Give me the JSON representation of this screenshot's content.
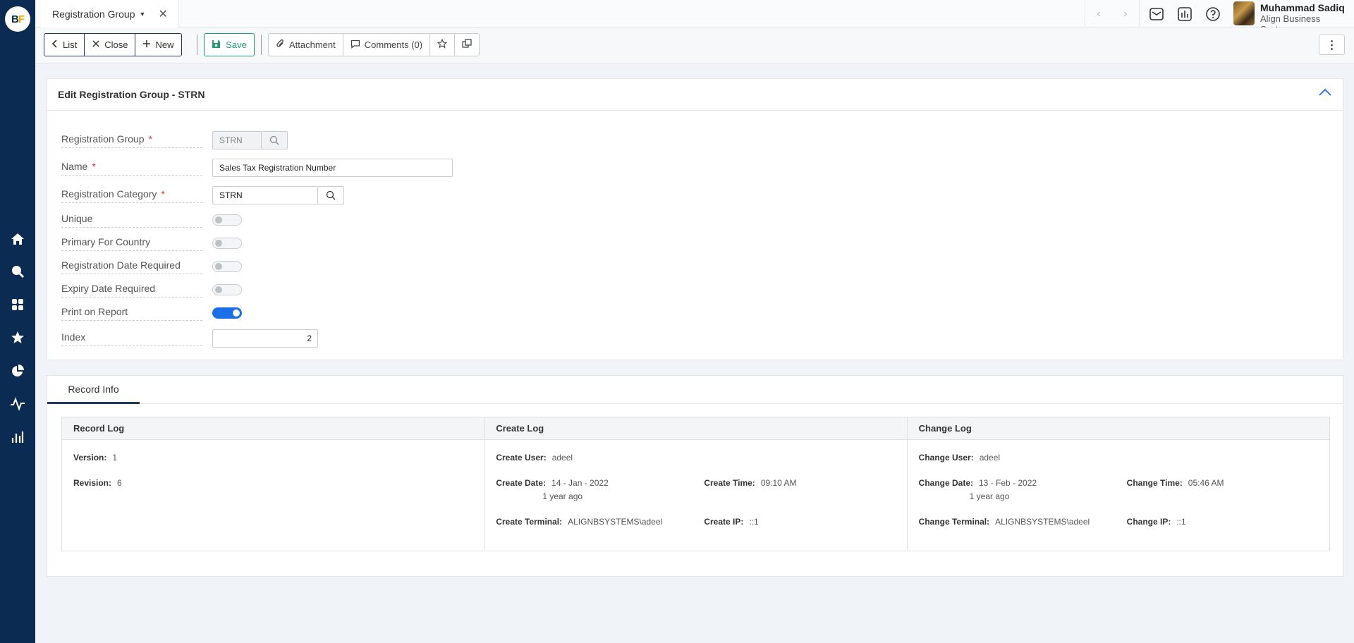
{
  "app": {
    "logo_text": "BF"
  },
  "header": {
    "tab_title": "Registration Group",
    "user_name": "Muhammad Sadiq",
    "company": "Align Business Systems"
  },
  "toolbar": {
    "list": "List",
    "close": "Close",
    "new": "New",
    "save": "Save",
    "attachment": "Attachment",
    "comments": "Comments (0)"
  },
  "form": {
    "title": "Edit Registration Group - STRN",
    "fields": {
      "registration_group": {
        "label": "Registration Group",
        "value": "STRN"
      },
      "name": {
        "label": "Name",
        "value": "Sales Tax Registration Number"
      },
      "registration_category": {
        "label": "Registration Category",
        "value": "STRN"
      },
      "unique": {
        "label": "Unique",
        "on": false
      },
      "primary_for_country": {
        "label": "Primary For Country",
        "on": false
      },
      "registration_date_required": {
        "label": "Registration Date Required",
        "on": false
      },
      "expiry_date_required": {
        "label": "Expiry Date Required",
        "on": false
      },
      "print_on_report": {
        "label": "Print on Report",
        "on": true
      },
      "index": {
        "label": "Index",
        "value": "2"
      }
    },
    "required_mark": "*"
  },
  "record_info": {
    "tab_label": "Record Info",
    "record_log": {
      "title": "Record Log",
      "version_label": "Version:",
      "version": "1",
      "revision_label": "Revision:",
      "revision": "6"
    },
    "create_log": {
      "title": "Create Log",
      "user_label": "Create User:",
      "user": "adeel",
      "date_label": "Create Date:",
      "date": "14 - Jan - 2022",
      "date_rel": "1 year ago",
      "time_label": "Create Time:",
      "time": "09:10 AM",
      "terminal_label": "Create Terminal:",
      "terminal": "ALIGNBSYSTEMS\\adeel",
      "ip_label": "Create IP:",
      "ip": "::1"
    },
    "change_log": {
      "title": "Change Log",
      "user_label": "Change User:",
      "user": "adeel",
      "date_label": "Change Date:",
      "date": "13 - Feb - 2022",
      "date_rel": "1 year ago",
      "time_label": "Change Time:",
      "time": "05:46 AM",
      "terminal_label": "Change Terminal:",
      "terminal": "ALIGNBSYSTEMS\\adeel",
      "ip_label": "Change IP:",
      "ip": "::1"
    }
  },
  "colors": {
    "sidebar": "#0c2b52",
    "accent": "#1a6fe8",
    "save": "#1f9e70"
  }
}
